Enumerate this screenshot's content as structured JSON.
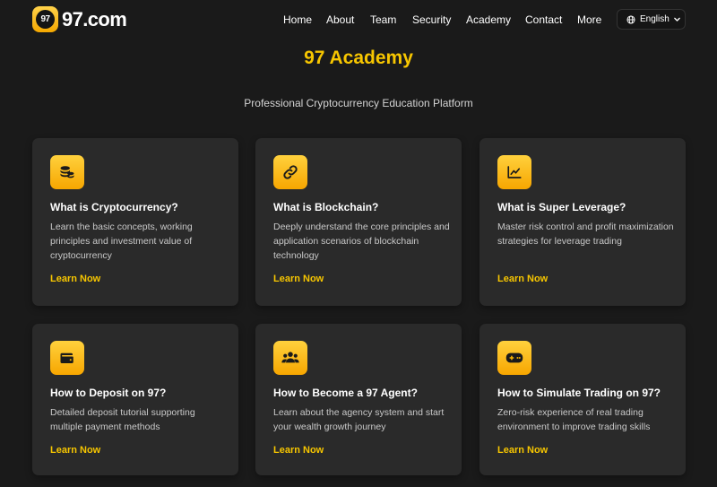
{
  "header": {
    "logo_badge": "97",
    "logo_text": "97.com",
    "nav": [
      "Home",
      "About",
      "Team",
      "Security",
      "Academy",
      "Contact",
      "More"
    ],
    "language": "English"
  },
  "main": {
    "title": "97 Academy",
    "subtitle": "Professional Cryptocurrency Education Platform",
    "cards": [
      {
        "icon": "coins-icon",
        "title": "What is Cryptocurrency?",
        "description": "Learn the basic concepts, working principles and investment value of cryptocurrency",
        "link": "Learn Now"
      },
      {
        "icon": "link-icon",
        "title": "What is Blockchain?",
        "description": "Deeply understand the core principles and application scenarios of blockchain technology",
        "link": "Learn Now"
      },
      {
        "icon": "chart-line-icon",
        "title": "What is Super Leverage?",
        "description": "Master risk control and profit maximization strategies for leverage trading",
        "link": "Learn Now"
      },
      {
        "icon": "wallet-icon",
        "title": "How to Deposit on 97?",
        "description": "Detailed deposit tutorial supporting multiple payment methods",
        "link": "Learn Now"
      },
      {
        "icon": "users-icon",
        "title": "How to Become a 97 Agent?",
        "description": "Learn about the agency system and start your wealth growth journey",
        "link": "Learn Now"
      },
      {
        "icon": "gamepad-icon",
        "title": "How to Simulate Trading on 97?",
        "description": "Zero-risk experience of real trading environment to improve trading skills",
        "link": "Learn Now"
      }
    ]
  },
  "colors": {
    "background": "#1a1a1a",
    "card": "#2a2a2a",
    "accent": "#f7c600"
  }
}
